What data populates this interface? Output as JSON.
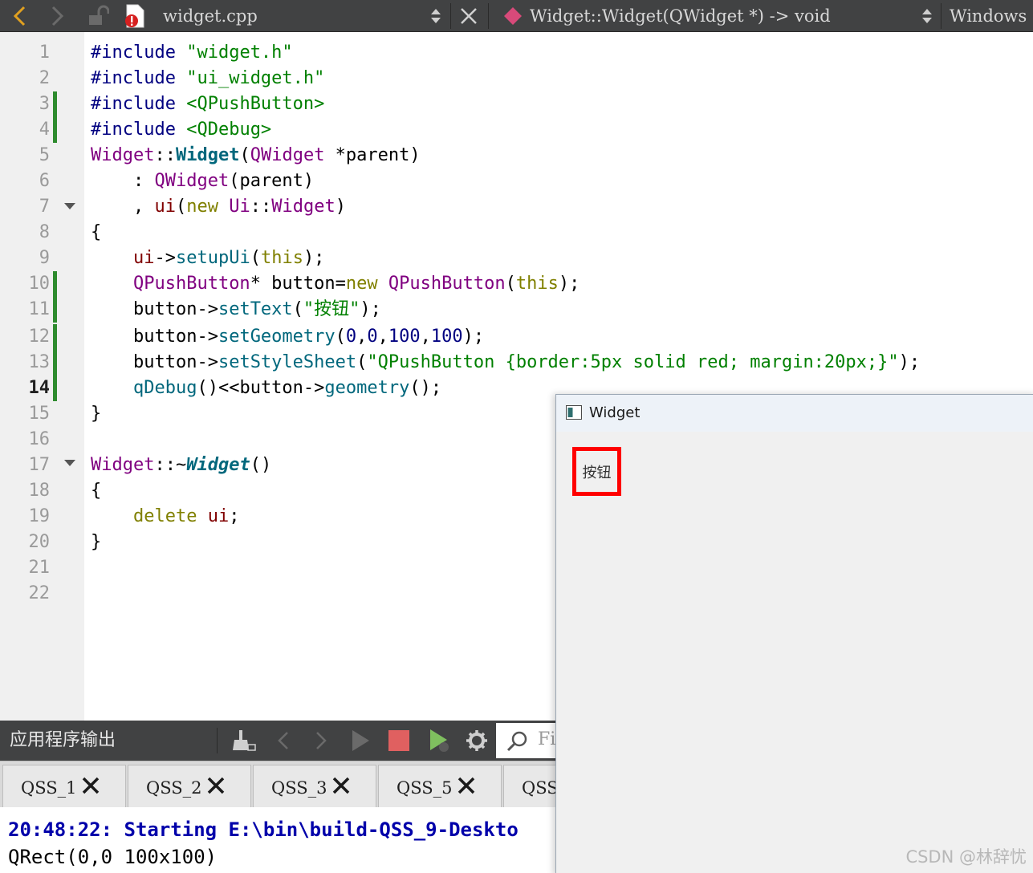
{
  "toolbar": {
    "file_name": "widget.cpp",
    "symbol": "Widget::Widget(QWidget *) -> void",
    "line_ending": "Windows"
  },
  "editor": {
    "line_numbers": [
      "1",
      "2",
      "3",
      "4",
      "5",
      "6",
      "7",
      "8",
      "9",
      "10",
      "11",
      "12",
      "13",
      "14",
      "15",
      "16",
      "17",
      "18",
      "19",
      "20",
      "21",
      "22"
    ],
    "current_line": "14",
    "lines": [
      "#include \"widget.h\"",
      "#include \"ui_widget.h\"",
      "#include <QPushButton>",
      "#include <QDebug>",
      "Widget::Widget(QWidget *parent)",
      "    : QWidget(parent)",
      "    , ui(new Ui::Widget)",
      "{",
      "    ui->setupUi(this);",
      "    QPushButton* button=new QPushButton(this);",
      "    button->setText(\"按钮\");",
      "    button->setGeometry(0,0,100,100);",
      "    button->setStyleSheet(\"QPushButton {border:5px solid red; margin:20px;}\");",
      "    qDebug()<<button->geometry();",
      "}",
      "",
      "Widget::~Widget()",
      "{",
      "    delete ui;",
      "}",
      "",
      ""
    ]
  },
  "output": {
    "title": "应用程序输出",
    "filter_placeholder": "Fi",
    "tabs": [
      "QSS_1",
      "QSS_2",
      "QSS_3",
      "QSS_5",
      "QSS_"
    ],
    "lines": [
      "20:48:22: Starting E:\\bin\\build-QSS_9-Deskto",
      "QRect(0,0 100x100)"
    ]
  },
  "widget_window": {
    "title": "Widget",
    "button_label": "按钮"
  },
  "watermark": "CSDN @林辞忧"
}
